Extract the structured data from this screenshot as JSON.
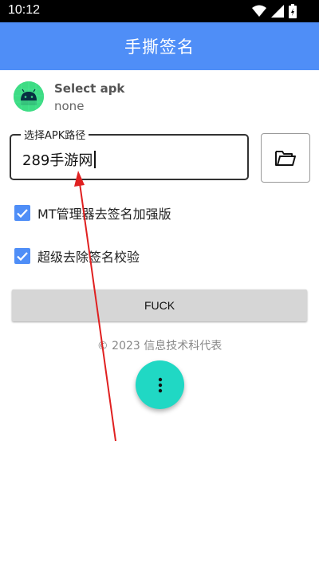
{
  "status_bar": {
    "time": "10:12"
  },
  "app_bar": {
    "title": "手撕签名"
  },
  "apk": {
    "title": "Select apk",
    "subtitle": "none"
  },
  "path_field": {
    "label": "选择APK路径",
    "value": "289手游网"
  },
  "options": [
    {
      "label": "MT管理器去签名加强版",
      "checked": true
    },
    {
      "label": "超级去除签名校验",
      "checked": true
    }
  ],
  "action_button": {
    "label": "FUCK"
  },
  "footer": {
    "text": "© 2023 信息技术科代表"
  },
  "icons": {
    "wifi": "wifi-icon",
    "signal": "signal-icon",
    "battery": "battery-icon",
    "folder": "folder-icon",
    "more": "more-vert-icon",
    "android": "android-icon"
  },
  "colors": {
    "primary": "#4f8ef7",
    "fab": "#20d8c4",
    "annotation_arrow": "#e02020"
  }
}
